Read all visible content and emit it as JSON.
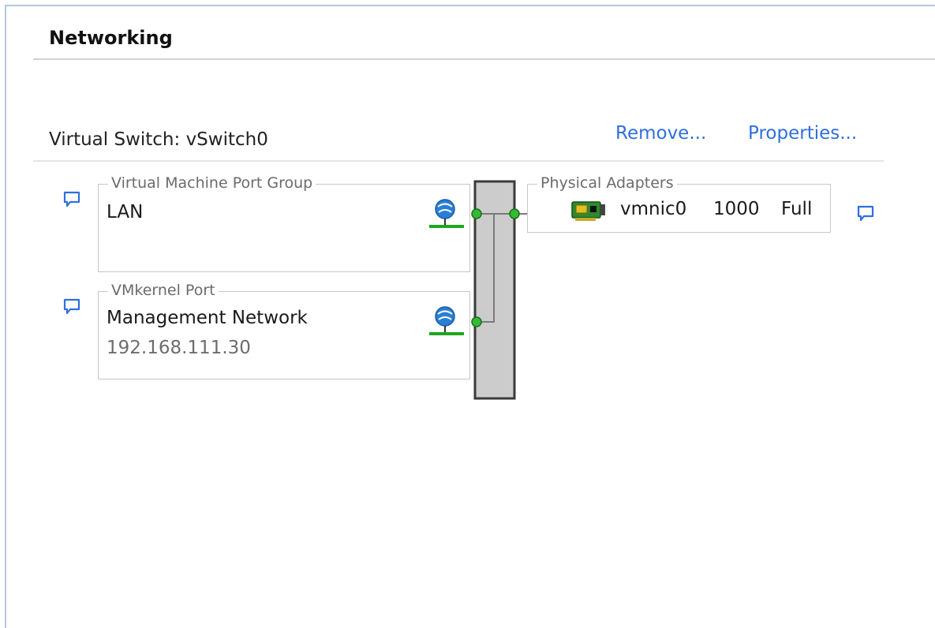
{
  "section": {
    "title": "Networking"
  },
  "vswitch": {
    "title": "Virtual Switch: vSwitch0",
    "remove_label": "Remove...",
    "properties_label": "Properties..."
  },
  "port_groups": [
    {
      "type": "Virtual Machine Port Group",
      "name": "LAN",
      "detail": ""
    },
    {
      "type": "VMkernel Port",
      "name": "Management Network",
      "detail": "192.168.111.30"
    }
  ],
  "physical_adapters": {
    "label": "Physical Adapters",
    "adapters": [
      {
        "name": "vmnic0",
        "speed": "1000",
        "duplex": "Full"
      }
    ]
  },
  "colors": {
    "link": "#2f6fde",
    "port_dot": "#33bb33",
    "port_line": "#1fa51f",
    "switch_fill": "#cccccc",
    "globe": "#2a7fd4",
    "nic_board": "#2f8a2f"
  },
  "icons": {
    "comment": "speech-bubble-icon",
    "port_group": "globe-network-icon",
    "adapter": "network-card-icon"
  }
}
